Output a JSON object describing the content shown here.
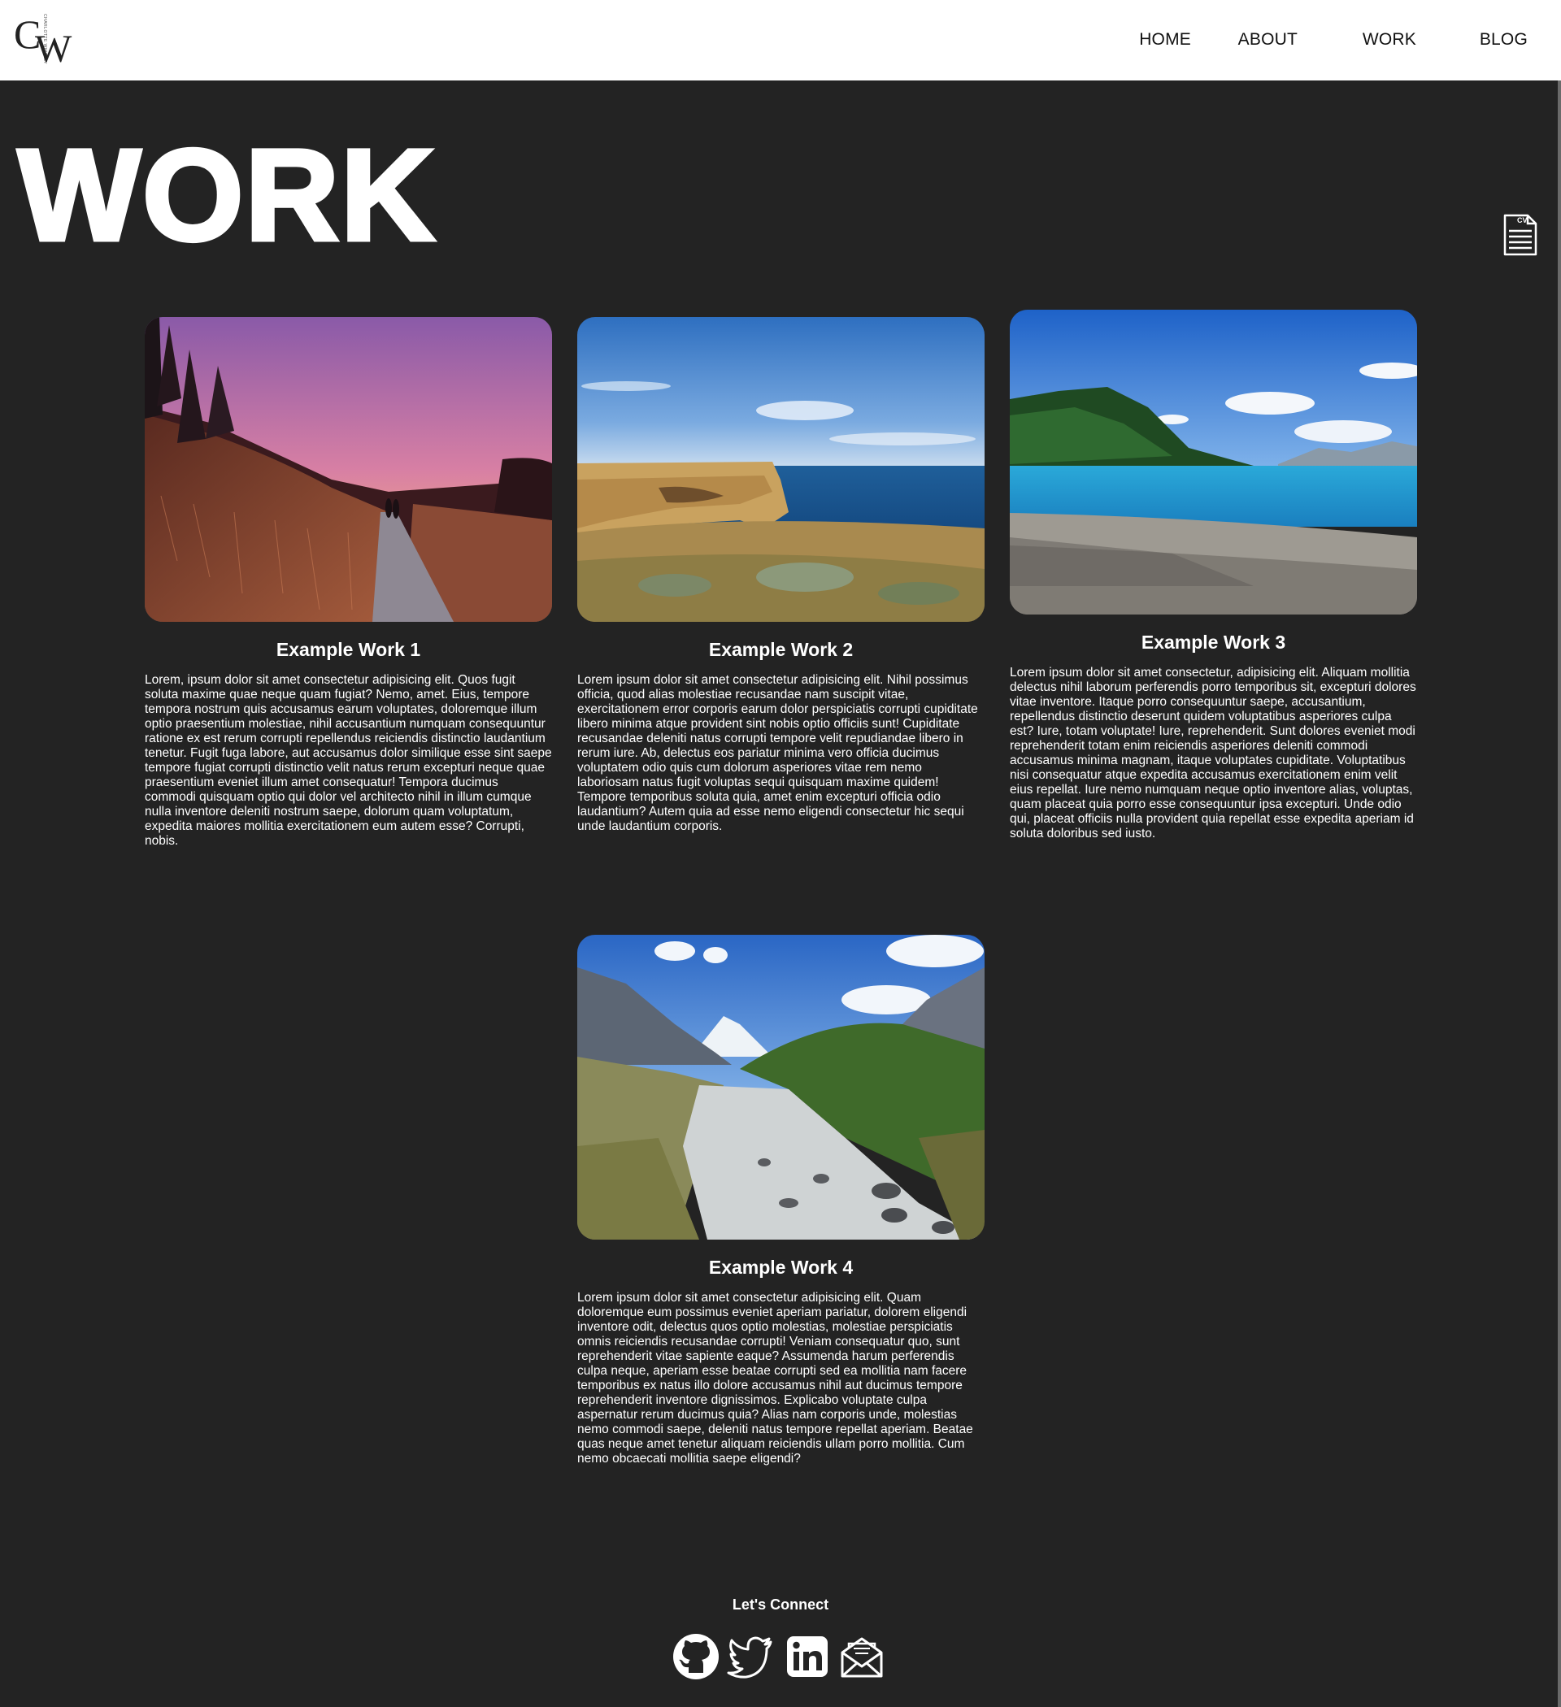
{
  "header": {
    "logo_letter_c": "C",
    "logo_letter_w": "W",
    "logo_small_text": "CHARLOTTE WHITELY"
  },
  "nav": {
    "home": "HOME",
    "about": "ABOUT",
    "work": "WORK",
    "blog": "BLOG"
  },
  "main": {
    "title": "WORK",
    "cv_label": "CV"
  },
  "works": [
    {
      "title": "Example Work 1",
      "description": "Lorem, ipsum dolor sit amet consectetur adipisicing elit. Quos fugit soluta maxime quae neque quam fugiat? Nemo, amet. Eius, tempore tempora nostrum quis accusamus earum voluptates, doloremque illum optio praesentium molestiae, nihil accusantium numquam consequuntur ratione ex est rerum corrupti repellendus reiciendis distinctio laudantium tenetur. Fugit fuga labore, aut accusamus dolor similique esse sint saepe tempore fugiat corrupti distinctio velit natus rerum excepturi neque quae praesentium eveniet illum amet consequatur! Tempora ducimus commodi quisquam optio qui dolor vel architecto nihil in illum cumque nulla inventore deleniti nostrum saepe, dolorum quam voluptatum, expedita maiores mollitia exercitationem eum autem esse? Corrupti, nobis."
    },
    {
      "title": "Example Work 2",
      "description": "Lorem ipsum dolor sit amet consectetur adipisicing elit. Nihil possimus officia, quod alias molestiae recusandae nam suscipit vitae, exercitationem error corporis earum dolor perspiciatis corrupti cupiditate libero minima atque provident sint nobis optio officiis sunt! Cupiditate recusandae deleniti natus corrupti tempore velit repudiandae libero in rerum iure. Ab, delectus eos pariatur minima vero officia ducimus voluptatem odio quis cum dolorum asperiores vitae rem nemo laboriosam natus fugit voluptas sequi quisquam maxime quidem! Tempore temporibus soluta quia, amet enim excepturi officia odio laudantium? Autem quia ad esse nemo eligendi consectetur hic sequi unde laudantium corporis."
    },
    {
      "title": "Example Work 3",
      "description": "Lorem ipsum dolor sit amet consectetur, adipisicing elit. Aliquam mollitia delectus nihil laborum perferendis porro temporibus sit, excepturi dolores vitae inventore. Itaque porro consequuntur saepe, accusantium, repellendus distinctio deserunt quidem voluptatibus asperiores culpa est? Iure, totam voluptate! Iure, reprehenderit. Sunt dolores eveniet modi reprehenderit totam enim reiciendis asperiores deleniti commodi accusamus minima magnam, itaque voluptates cupiditate. Voluptatibus nisi consequatur atque expedita accusamus exercitationem enim velit eius repellat. Iure nemo numquam neque optio inventore alias, voluptas, quam placeat quia porro esse consequuntur ipsa excepturi. Unde odio qui, placeat officiis nulla provident quia repellat esse expedita aperiam id soluta doloribus sed iusto."
    },
    {
      "title": "Example Work 4",
      "description": "Lorem ipsum dolor sit amet consectetur adipisicing elit. Quam doloremque eum possimus eveniet aperiam pariatur, dolorem eligendi inventore odit, delectus quos optio molestias, molestiae perspiciatis omnis reiciendis recusandae corrupti! Veniam consequatur quo, sunt reprehenderit vitae sapiente eaque? Assumenda harum perferendis culpa neque, aperiam esse beatae corrupti sed ea mollitia nam facere temporibus ex natus illo dolore accusamus nihil aut ducimus tempore reprehenderit inventore dignissimos. Explicabo voluptate culpa aspernatur rerum ducimus quia? Alias nam corporis unde, molestias nemo commodi saepe, deleniti natus tempore repellat aperiam. Beatae quas neque amet tenetur aliquam reiciendis ullam porro mollitia. Cum nemo obcaecati mollitia saepe eligendi?"
    }
  ],
  "footer": {
    "heading": "Let's Connect",
    "socials": [
      "github-icon",
      "twitter-icon",
      "linkedin-icon",
      "email-icon"
    ]
  },
  "colors": {
    "background": "#232323",
    "header": "#ffffff",
    "text": "#ffffff",
    "nav_text": "#111111"
  }
}
